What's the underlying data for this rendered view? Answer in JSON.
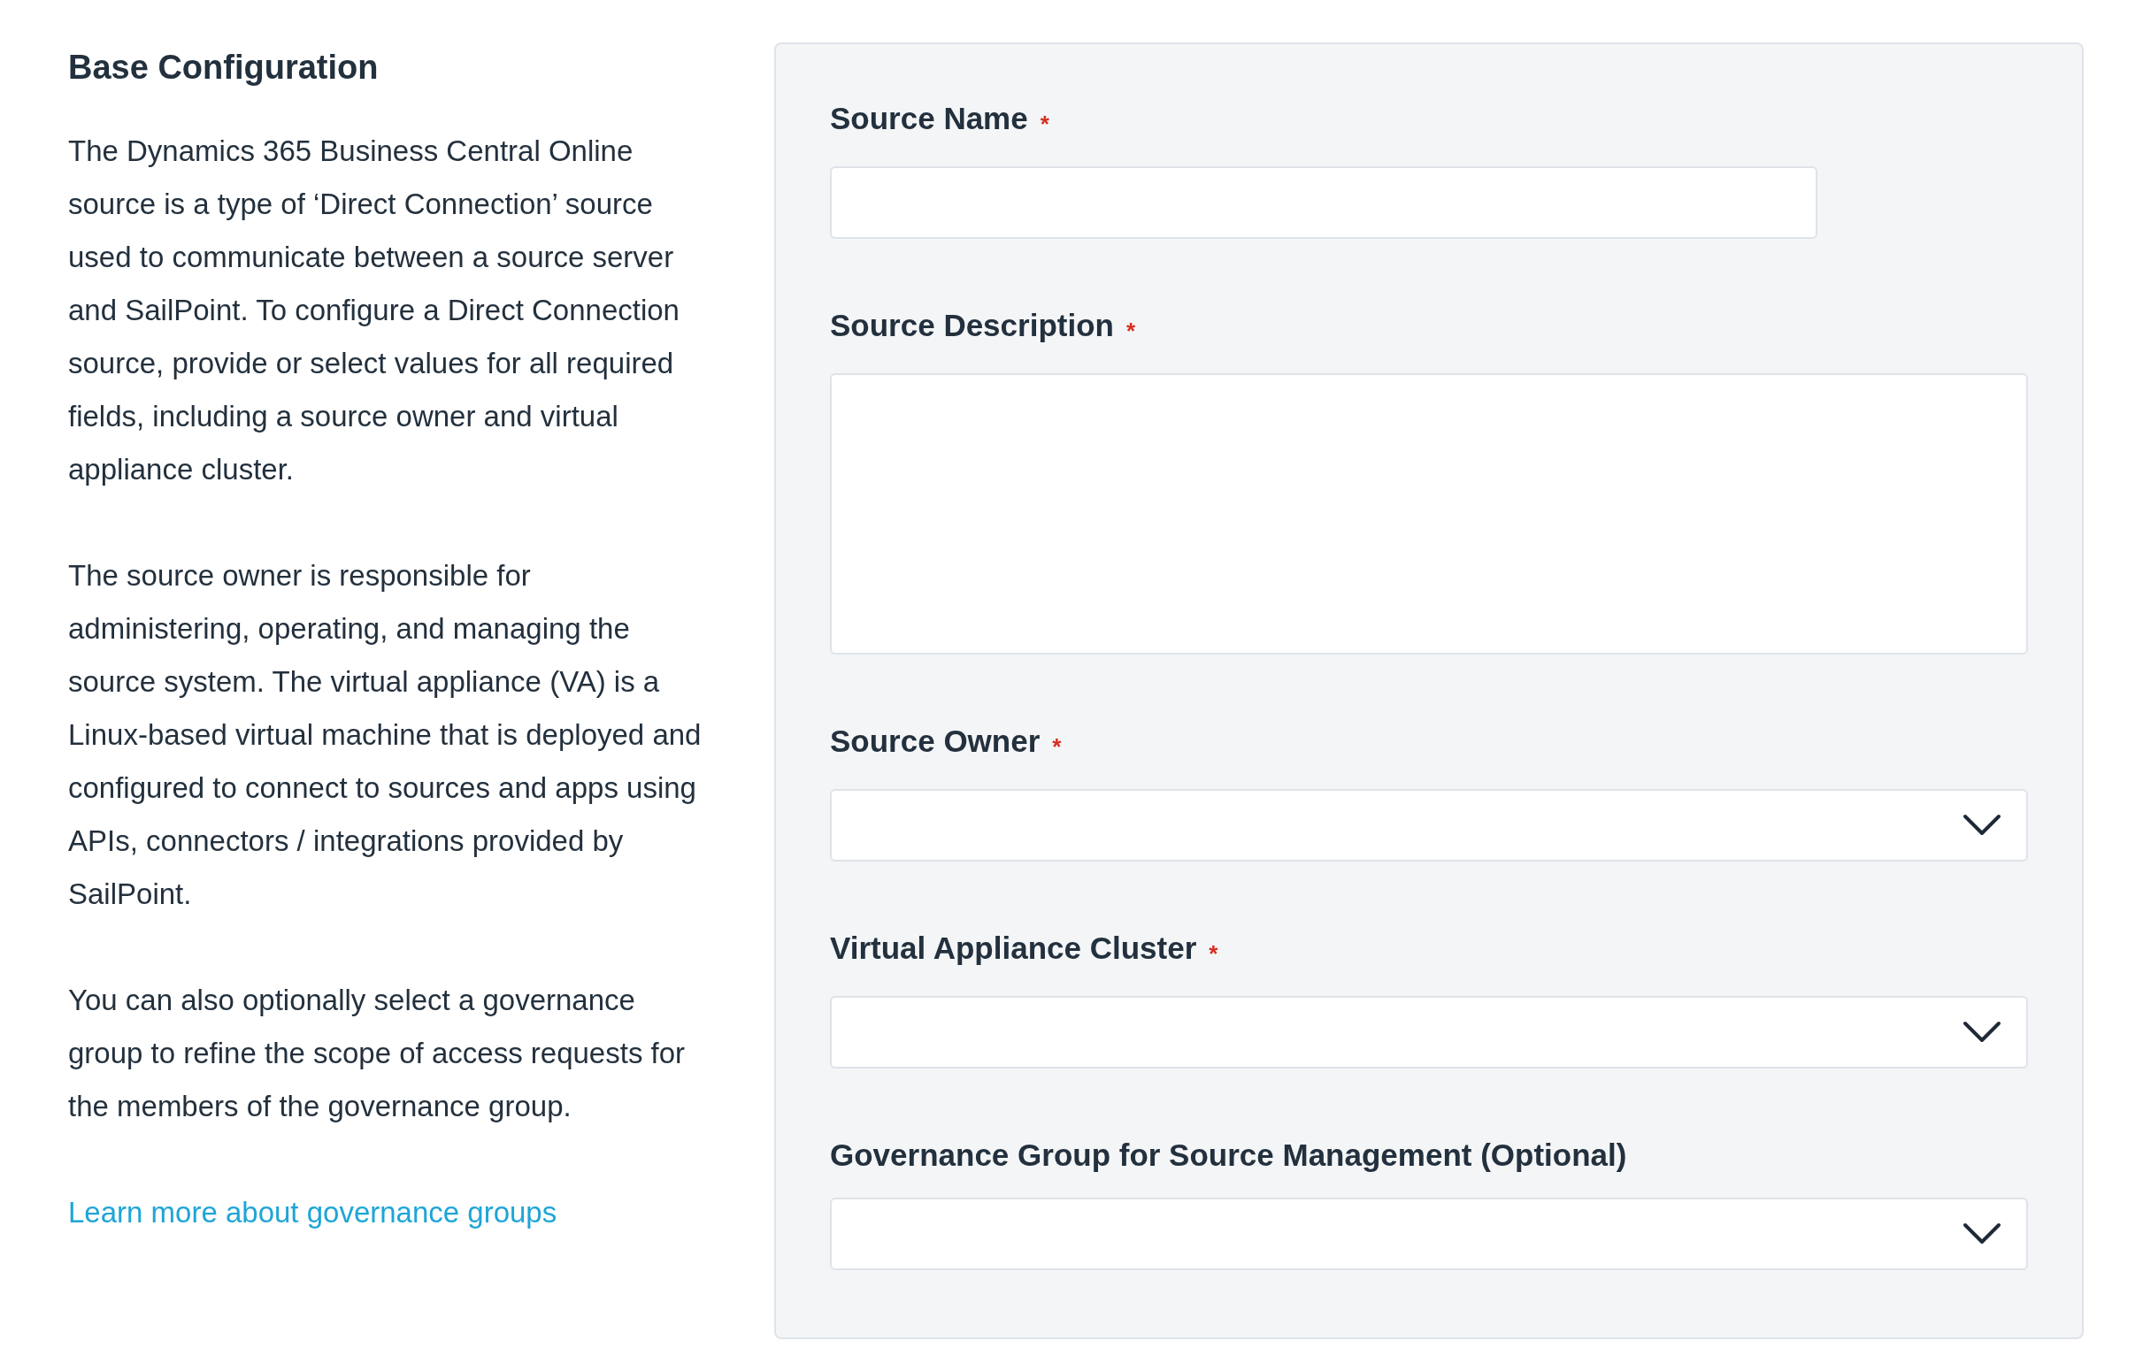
{
  "section": {
    "title": "Base Configuration",
    "paragraphs": [
      "The Dynamics 365 Business Central Online source is a type of ‘Direct Connection’ source used to communicate between a source server and SailPoint. To configure a Direct Connection source, provide or select values for all required fields, including a source owner and virtual appliance cluster.",
      "The source owner is responsible for administering, operating, and managing the source system. The virtual appliance (VA) is a Linux-based virtual machine that is deployed and configured to connect to sources and apps using APIs, connectors / integrations provided by SailPoint.",
      "You can also optionally select a governance group to refine the scope of access requests for the members of the governance group."
    ],
    "link": "Learn more about governance groups"
  },
  "form": {
    "fields": [
      {
        "kind": "text",
        "label": "Source Name",
        "required_mark": "*"
      },
      {
        "kind": "textarea",
        "label": "Source Description",
        "required_mark": "*"
      },
      {
        "kind": "select",
        "label": "Source Owner",
        "required_mark": "*"
      },
      {
        "kind": "select",
        "label": "Virtual Appliance Cluster",
        "required_mark": "*"
      },
      {
        "kind": "select",
        "label": "Governance Group for Source Management (Optional)"
      }
    ]
  }
}
